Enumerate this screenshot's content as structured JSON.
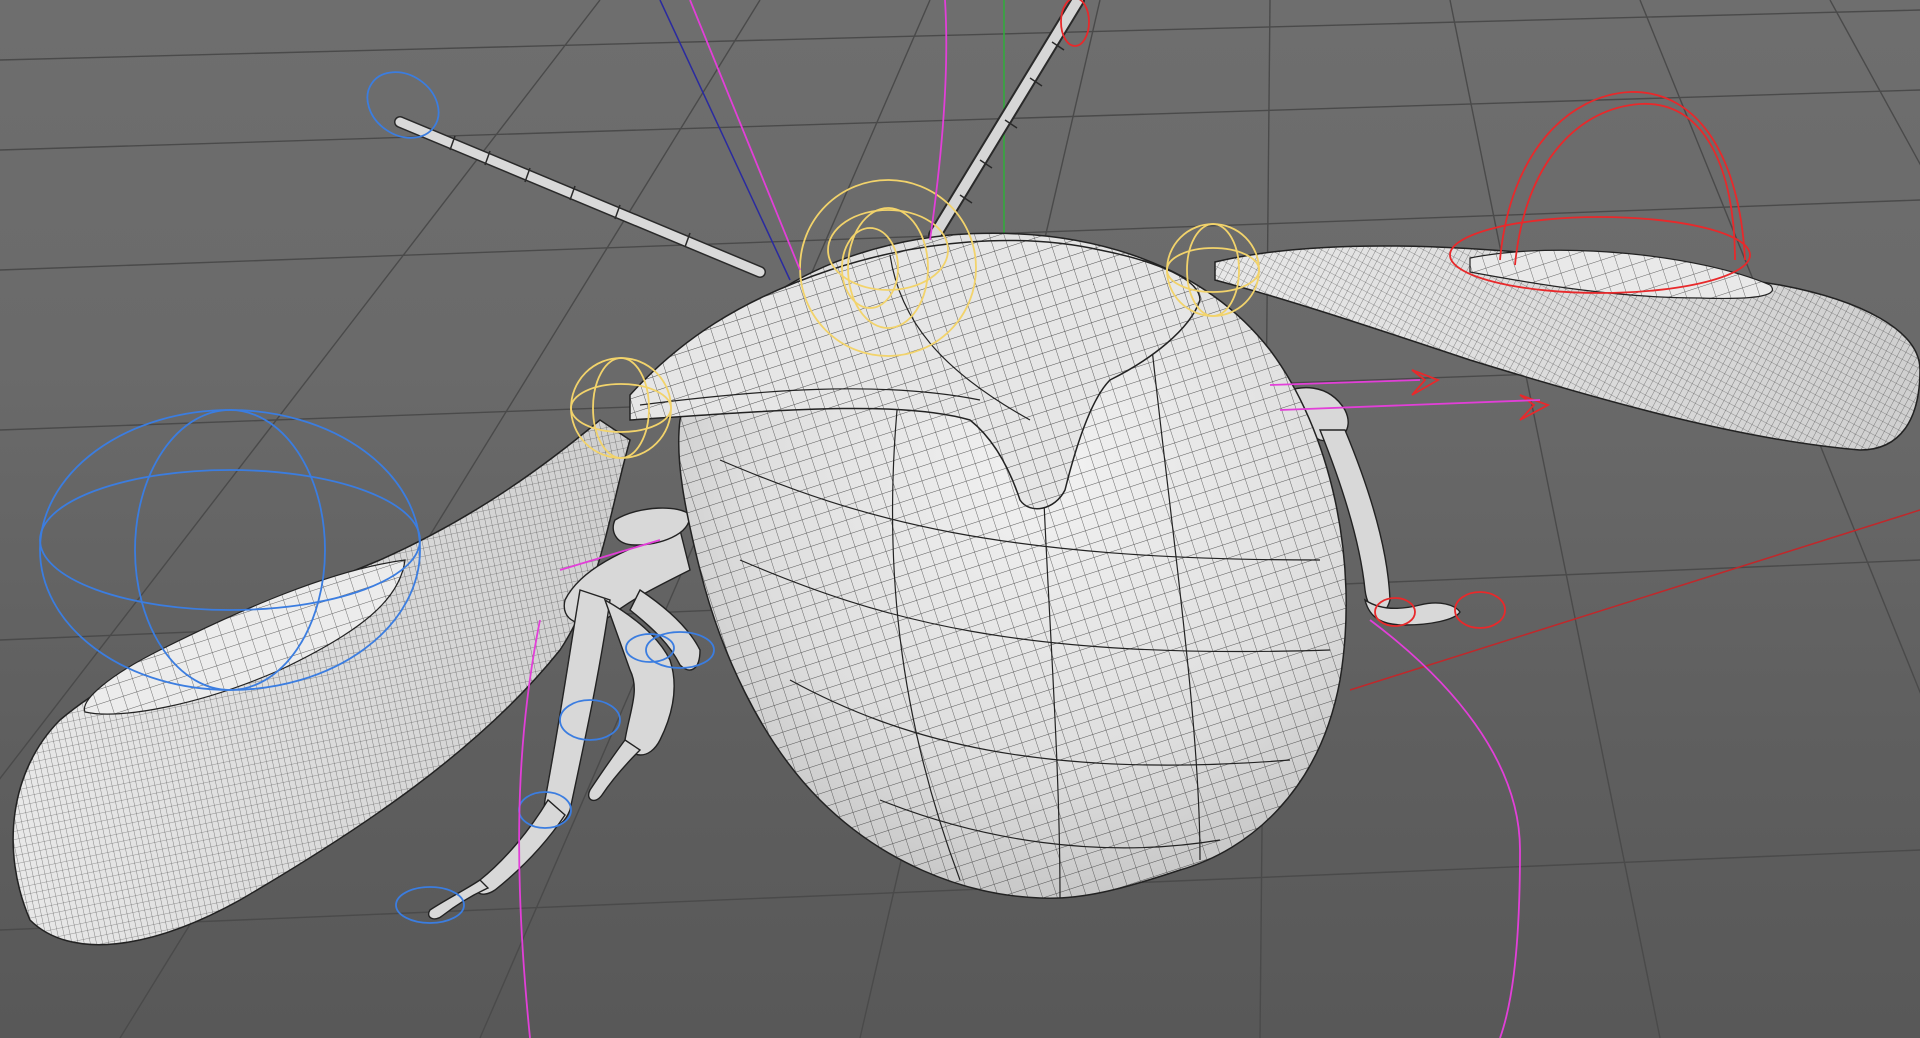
{
  "viewport": {
    "colors": {
      "background": "#666666",
      "grid": "#4a4a4a",
      "mesh_fill": "#dcdcdc",
      "mesh_wire": "#232323",
      "control_yellow": "#f2d36b",
      "control_blue": "#3b7de0",
      "control_red": "#e8292b",
      "control_magenta": "#e23fd8",
      "axis_green": "#2fae3a",
      "axis_blue": "#2a2aa0",
      "axis_red": "#c0282b"
    }
  },
  "scene": {
    "objects": [
      "ground-grid",
      "beetle-body-shell",
      "beetle-pronotum",
      "left-wing",
      "right-wing",
      "left-antenna",
      "right-antenna",
      "front-legs",
      "rear-leg"
    ],
    "rig_controls": [
      "yellow-joint-controller",
      "blue-wing-controller",
      "red-wing-controller",
      "magenta-ik-curve"
    ]
  }
}
